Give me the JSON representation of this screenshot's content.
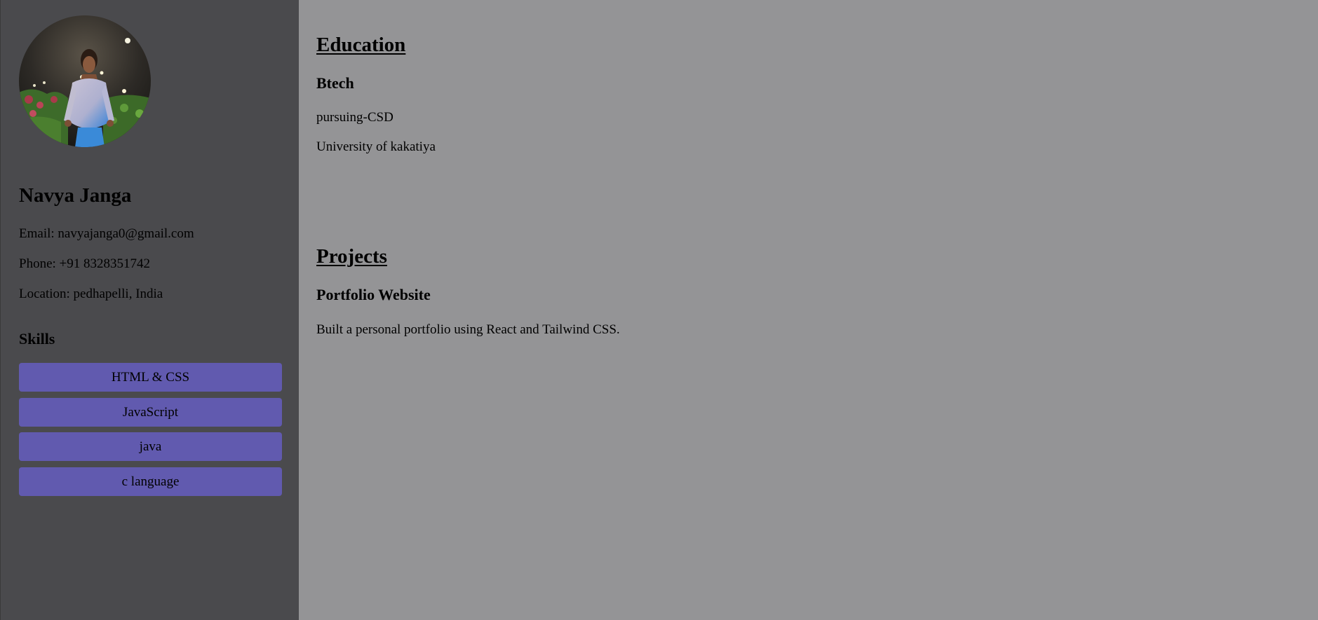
{
  "profile": {
    "name": "Navya Janga",
    "email": "Email: navyajanga0@gmail.com",
    "phone": "Phone: +91 8328351742",
    "location": "Location: pedhapelli, India"
  },
  "skills": {
    "title": "Skills",
    "items": [
      {
        "label": "HTML & CSS"
      },
      {
        "label": "JavaScript"
      },
      {
        "label": "java"
      },
      {
        "label": "c language"
      }
    ]
  },
  "education": {
    "title": "Education",
    "degree": "Btech",
    "status": "pursuing-CSD",
    "university": "University of kakatiya"
  },
  "projects": {
    "title": "Projects",
    "items": [
      {
        "name": "Portfolio Website",
        "description": "Built a personal portfolio using React and Tailwind CSS."
      }
    ]
  },
  "colors": {
    "sidebar_bg": "#4a4a4d",
    "main_bg": "#949496",
    "skill_bg": "#615aaf"
  }
}
